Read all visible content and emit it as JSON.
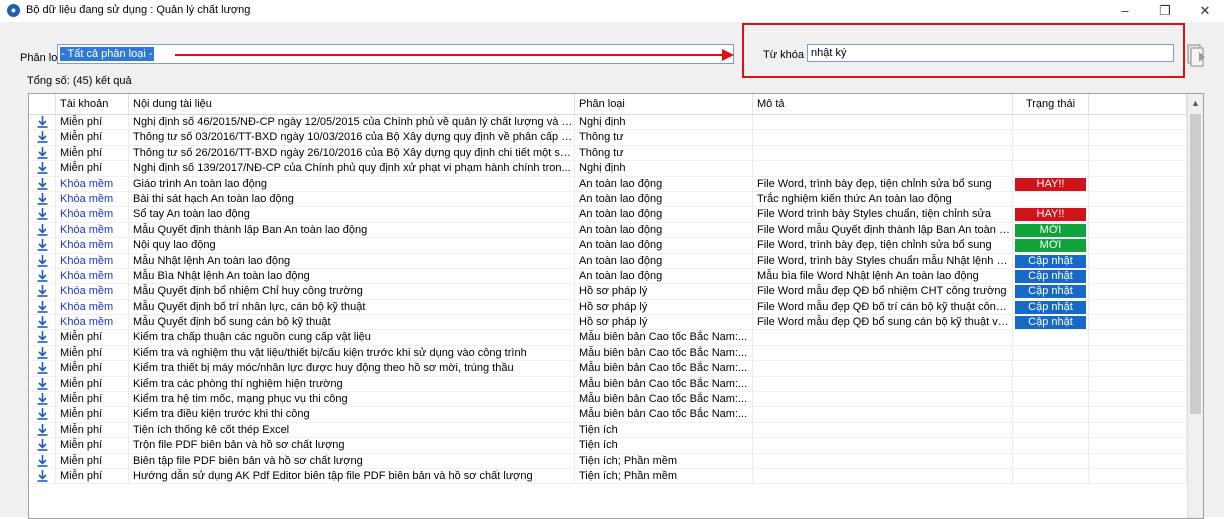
{
  "window": {
    "title": "Bộ dữ liệu đang sử dụng : Quản lý chất lượng"
  },
  "filters": {
    "category_label": "Phân loại",
    "category_value": "- Tất cả phân loại -",
    "keyword_label": "Từ khóa",
    "keyword_value": "nhật ký"
  },
  "result_count": "Tổng số: (45) kết quả",
  "colors": {
    "hay": "#d0121b",
    "moi": "#10a33c",
    "capnhat": "#1668c9",
    "premium_text": "#1a35c8",
    "annotation": "#e0101a"
  },
  "table": {
    "headers": {
      "account": "Tài khoản",
      "name": "Nội dung tài liệu",
      "category": "Phân loại",
      "description": "Mô tả",
      "status": "Trạng thái"
    },
    "rows": [
      {
        "account": "Miễn phí",
        "premium": false,
        "name": "Nghị định số 46/2015/NĐ-CP ngày 12/05/2015 của Chính phủ về quản lý chất lượng và b...",
        "category": "Nghị định",
        "description": "",
        "status": "",
        "status_type": ""
      },
      {
        "account": "Miễn phí",
        "premium": false,
        "name": "Thông tư số 03/2016/TT-BXD ngày 10/03/2016 của Bộ Xây dựng quy định về phân cấp c...",
        "category": "Thông tư",
        "description": "",
        "status": "",
        "status_type": ""
      },
      {
        "account": "Miễn phí",
        "premium": false,
        "name": "Thông tư số 26/2016/TT-BXD ngày 26/10/2016 của Bộ Xây dựng quy định chi tiết một số ...",
        "category": "Thông tư",
        "description": "",
        "status": "",
        "status_type": ""
      },
      {
        "account": "Miễn phí",
        "premium": false,
        "name": "Nghị định số 139/2017/NĐ-CP của Chính phủ quy định xử phạt vi phạm hành chính tron...",
        "category": "Nghị định",
        "description": "",
        "status": "",
        "status_type": ""
      },
      {
        "account": "Khóa mềm",
        "premium": true,
        "name": "Giáo trình An toàn lao động",
        "category": "An toàn lao động",
        "description": "File Word, trình bày đẹp, tiện chỉnh sửa bổ sung",
        "status": "HAY!!",
        "status_type": "hay"
      },
      {
        "account": "Khóa mềm",
        "premium": true,
        "name": "Bài thi sát hạch An toàn lao động",
        "category": "An toàn lao động",
        "description": "Trắc nghiệm kiến thức An toàn lao động",
        "status": "",
        "status_type": ""
      },
      {
        "account": "Khóa mềm",
        "premium": true,
        "name": "Sổ tay An toàn lao động",
        "category": "An toàn lao động",
        "description": "File Word trình bày Styles chuẩn, tiện chỉnh sửa",
        "status": "HAY!!",
        "status_type": "hay"
      },
      {
        "account": "Khóa mềm",
        "premium": true,
        "name": "Mẫu Quyết định thành lập Ban An toàn lao động",
        "category": "An toàn lao động",
        "description": "File Word mẫu Quyết định thành lập Ban An toàn la...",
        "status": "MỚI",
        "status_type": "moi"
      },
      {
        "account": "Khóa mềm",
        "premium": true,
        "name": "Nội quy lao động",
        "category": "An toàn lao động",
        "description": "File Word, trình bày đẹp, tiện chỉnh sửa bổ sung",
        "status": "MỚI",
        "status_type": "moi"
      },
      {
        "account": "Khóa mềm",
        "premium": true,
        "name": "Mẫu Nhật lệnh An toàn lao động",
        "category": "An toàn lao động",
        "description": "File Word, trình bày Styles chuẩn mẫu Nhật lệnh ha...",
        "status": "Cập nhật",
        "status_type": "capnhat"
      },
      {
        "account": "Khóa mềm",
        "premium": true,
        "name": "Mẫu Bìa Nhật lệnh An toàn lao động",
        "category": "An toàn lao động",
        "description": "Mẫu bìa file Word Nhật lệnh An toàn lao động",
        "status": "Cập nhật",
        "status_type": "capnhat"
      },
      {
        "account": "Khóa mềm",
        "premium": true,
        "name": "Mẫu Quyết định bổ nhiệm Chỉ huy công trường",
        "category": "Hồ sơ pháp lý",
        "description": "File Word mẫu đẹp QĐ bổ nhiệm CHT công trường",
        "status": "Cập nhật",
        "status_type": "capnhat"
      },
      {
        "account": "Khóa mềm",
        "premium": true,
        "name": "Mẫu Quyết định bố trí nhân lực, cán bộ kỹ thuật",
        "category": "Hồ sơ pháp lý",
        "description": "File Word mẫu đẹp QĐ bố trí cán bộ kỹ thuật công tr...",
        "status": "Cập nhật",
        "status_type": "capnhat"
      },
      {
        "account": "Khóa mềm",
        "premium": true,
        "name": "Mẫu Quyết định bổ sung cán bộ kỹ thuật",
        "category": "Hồ sơ pháp lý",
        "description": "File Word mẫu đẹp QĐ bổ sung cán bộ kỹ thuật vào...",
        "status": "Cập nhật",
        "status_type": "capnhat"
      },
      {
        "account": "Miễn phí",
        "premium": false,
        "name": "Kiểm tra chấp thuận các nguồn cung cấp vật liệu",
        "category": "Mẫu biên bản Cao tốc Bắc Nam:...",
        "description": "",
        "status": "",
        "status_type": ""
      },
      {
        "account": "Miễn phí",
        "premium": false,
        "name": "Kiểm tra và nghiệm thu vật liệu/thiết bị/cấu kiện trước khi sử dụng vào công trình",
        "category": "Mẫu biên bản Cao tốc Bắc Nam:...",
        "description": "",
        "status": "",
        "status_type": ""
      },
      {
        "account": "Miễn phí",
        "premium": false,
        "name": "Kiểm tra thiết bị máy móc/nhân lực được huy động theo hồ sơ mời, trúng thầu",
        "category": "Mẫu biên bản Cao tốc Bắc Nam:...",
        "description": "",
        "status": "",
        "status_type": ""
      },
      {
        "account": "Miễn phí",
        "premium": false,
        "name": "Kiểm tra các phòng thí nghiệm hiện trường",
        "category": "Mẫu biên bản Cao tốc Bắc Nam:...",
        "description": "",
        "status": "",
        "status_type": ""
      },
      {
        "account": "Miễn phí",
        "premium": false,
        "name": "Kiểm tra hệ tim mốc, mạng phục vụ thi công",
        "category": "Mẫu biên bản Cao tốc Bắc Nam:...",
        "description": "",
        "status": "",
        "status_type": ""
      },
      {
        "account": "Miễn phí",
        "premium": false,
        "name": "Kiểm tra điều kiện trước khi thi công",
        "category": "Mẫu biên bản Cao tốc Bắc Nam:...",
        "description": "",
        "status": "",
        "status_type": ""
      },
      {
        "account": "Miễn phí",
        "premium": false,
        "name": "Tiện ích thống kê cốt thép Excel",
        "category": "Tiện ích",
        "description": "",
        "status": "",
        "status_type": ""
      },
      {
        "account": "Miễn phí",
        "premium": false,
        "name": "Trộn file PDF biên bản và hồ sơ chất lượng",
        "category": "Tiện ích",
        "description": "",
        "status": "",
        "status_type": ""
      },
      {
        "account": "Miễn phí",
        "premium": false,
        "name": "Biên tập file PDF biên bản và hồ sơ chất lượng",
        "category": "Tiện ích; Phần mềm",
        "description": "",
        "status": "",
        "status_type": ""
      },
      {
        "account": "Miễn phí",
        "premium": false,
        "name": "Hướng dẫn sử dụng AK Pdf Editor biên tập file PDF biên bản và hồ sơ chất lượng",
        "category": "Tiện ích; Phần mềm",
        "description": "",
        "status": "",
        "status_type": ""
      }
    ]
  }
}
